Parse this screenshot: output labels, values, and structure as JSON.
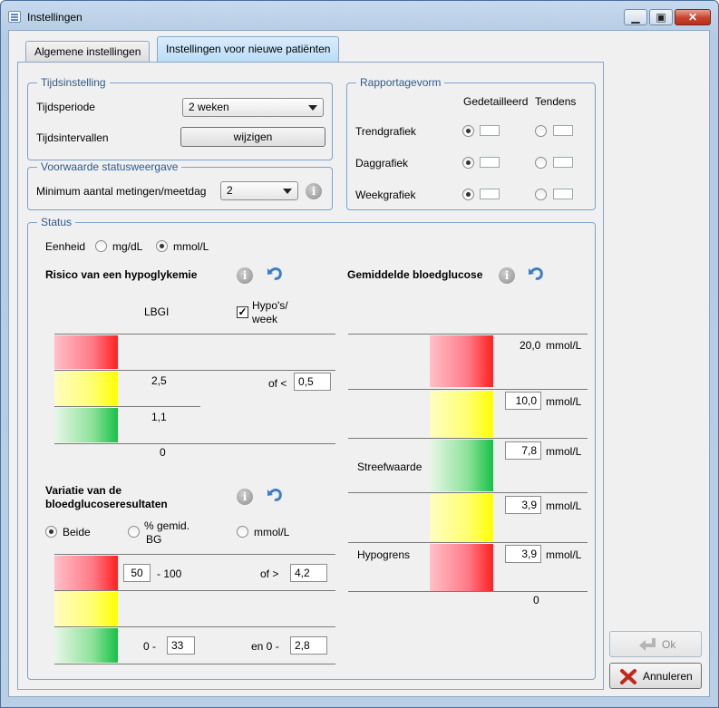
{
  "window": {
    "title": "Instellingen"
  },
  "tabs": [
    {
      "label": "Algemene instellingen",
      "active": false
    },
    {
      "label": "Instellingen voor nieuwe patiënten",
      "active": true
    }
  ],
  "tijdsinstelling": {
    "group_title": "Tijdsinstelling",
    "period_label": "Tijdsperiode",
    "period_value": "2 weken",
    "interval_label": "Tijdsintervallen",
    "interval_button": "wijzigen"
  },
  "voorwaarde": {
    "group_title": "Voorwaarde statusweergave",
    "min_label": "Minimum aantal metingen/meetdag",
    "min_value": "2"
  },
  "rapportage": {
    "group_title": "Rapportagevorm",
    "col_detail": "Gedetailleerd",
    "col_trend": "Tendens",
    "rows": [
      {
        "label": "Trendgrafiek",
        "selected": "detail"
      },
      {
        "label": "Daggrafiek",
        "selected": "detail"
      },
      {
        "label": "Weekgrafiek",
        "selected": "detail"
      }
    ]
  },
  "status": {
    "group_title": "Status",
    "unit_label": "Eenheid",
    "unit_options": [
      "mg/dL",
      "mmol/L"
    ],
    "unit_selected": "mmol/L",
    "hypo": {
      "title": "Risico van een hypoglykemie",
      "lbgi_label": "LBGI",
      "hypos_label_1": "Hypo's/",
      "hypos_label_2": "week",
      "hypos_checked": true,
      "val_high": "2,5",
      "val_low": "1,1",
      "val_zero": "0",
      "of_label": "of <",
      "hypos_value": "0,5"
    },
    "variatie": {
      "title_1": "Variatie van de",
      "title_2": "bloedglucoseresultaten",
      "opt_both": "Beide",
      "opt_pct_1": "% gemid.",
      "opt_pct_2": "BG",
      "opt_mmol": "mmol/L",
      "selected": "Beide",
      "pct_high_value": "50",
      "pct_high_suffix": "- 100",
      "of_gt": "of  >",
      "mmol_high_value": "4,2",
      "pct_low_prefix": "0  -",
      "pct_low_value": "33",
      "en_label": "en  0  -",
      "mmol_low_value": "2,8"
    },
    "gemiddelde": {
      "title": "Gemiddelde bloedglucose",
      "top_value": "20,0",
      "unit": "mmol/L",
      "value_2": "10,0",
      "value_3": "7,8",
      "value_4": "3,9",
      "value_5": "3,9",
      "streef_label": "Streefwaarde",
      "hypogrens_label": "Hypogrens",
      "zero": "0"
    }
  },
  "buttons": {
    "ok": "Ok",
    "cancel": "Annuleren"
  }
}
